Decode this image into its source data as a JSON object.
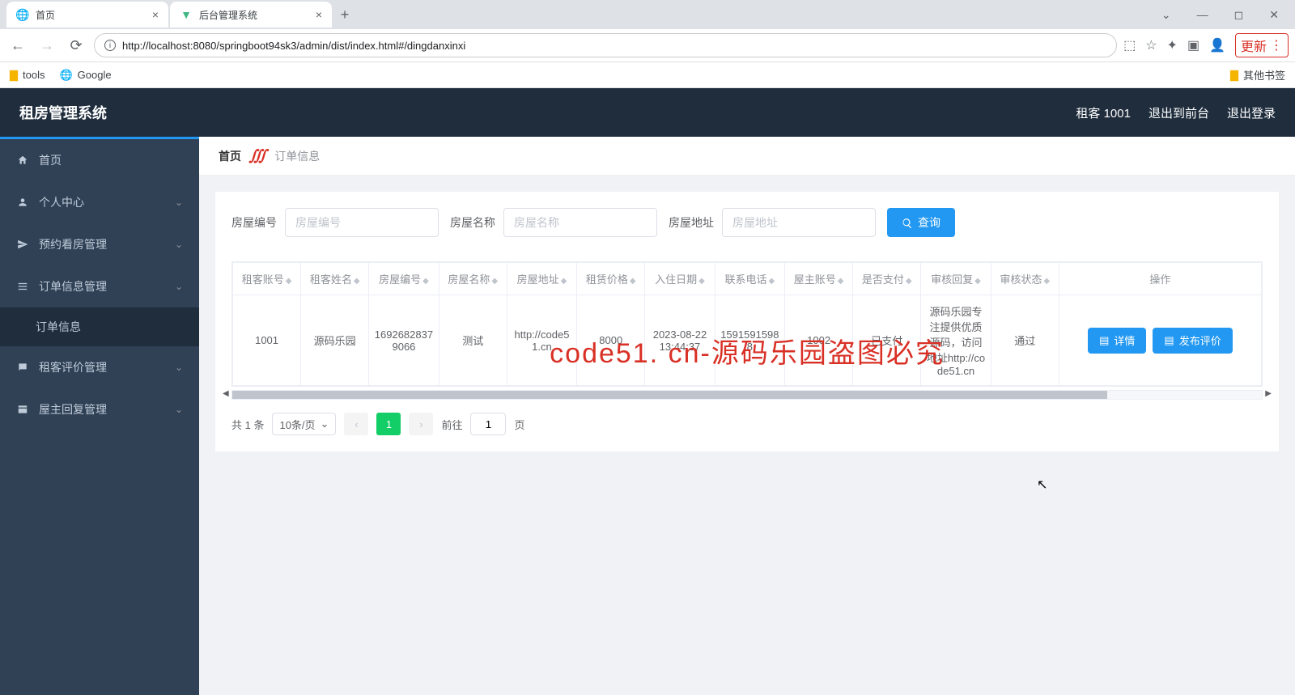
{
  "browser": {
    "tabs": [
      {
        "icon": "globe",
        "title": "首页"
      },
      {
        "icon": "vue",
        "title": "后台管理系统"
      }
    ],
    "url": "http://localhost:8080/springboot94sk3/admin/dist/index.html#/dingdanxinxi",
    "update_label": "更新",
    "bookmarks": {
      "tools": "tools",
      "google": "Google",
      "other": "其他书签"
    }
  },
  "app": {
    "title": "租房管理系统",
    "header_right": {
      "user": "租客 1001",
      "front": "退出到前台",
      "logout": "退出登录"
    },
    "menu": {
      "home": "首页",
      "personal": "个人中心",
      "appointment": "预约看房管理",
      "order": "订单信息管理",
      "order_sub": "订单信息",
      "review": "租客评价管理",
      "reply": "屋主回复管理"
    },
    "breadcrumb": {
      "home": "首页",
      "current": "订单信息"
    },
    "search": {
      "f1_label": "房屋编号",
      "f1_placeholder": "房屋编号",
      "f2_label": "房屋名称",
      "f2_placeholder": "房屋名称",
      "f3_label": "房屋地址",
      "f3_placeholder": "房屋地址",
      "btn": "查询"
    },
    "table": {
      "headers": {
        "tenant_account": "租客账号",
        "tenant_name": "租客姓名",
        "house_no": "房屋编号",
        "house_name": "房屋名称",
        "house_addr": "房屋地址",
        "rent": "租赁价格",
        "checkin": "入住日期",
        "phone": "联系电话",
        "owner_account": "屋主账号",
        "paid": "是否支付",
        "reply": "审核回复",
        "status": "审核状态",
        "ops": "操作"
      },
      "rows": [
        {
          "tenant_account": "1001",
          "tenant_name": "源码乐园",
          "house_no": "16926828379066",
          "house_name": "测试",
          "house_addr": "http://code51.cn",
          "rent": "8000",
          "checkin": "2023-08-22 13:44:37",
          "phone": "15915915988",
          "owner_account": "1002",
          "paid": "已支付",
          "reply": "源码乐园专注提供优质源码，访问地址http://code51.cn",
          "status": "通过"
        }
      ],
      "btn_detail": "详情",
      "btn_review": "发布评价"
    },
    "pagination": {
      "total": "共 1 条",
      "page_size": "10条/页",
      "current": "1",
      "goto_prefix": "前往",
      "goto_value": "1",
      "goto_suffix": "页"
    }
  },
  "watermark": "code51. cn-源码乐园盗图必究"
}
